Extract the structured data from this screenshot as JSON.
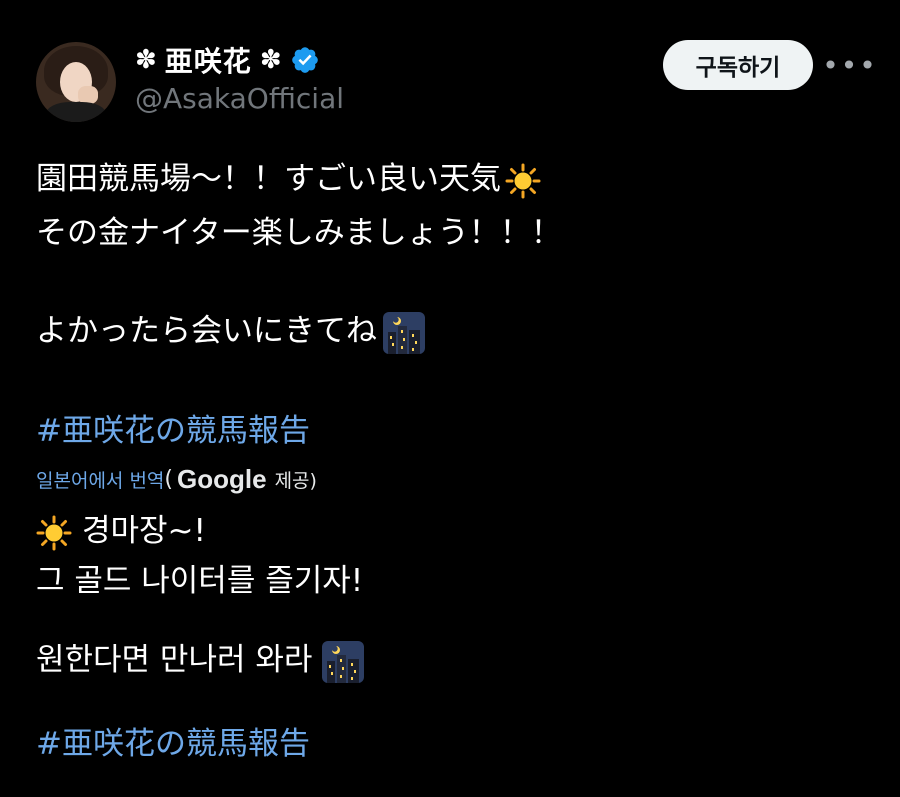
{
  "author": {
    "name_prefix": "✽",
    "display_name": "亜咲花",
    "name_suffix": "✽",
    "handle": "@AsakaOfficial"
  },
  "actions": {
    "follow_label": "구독하기",
    "more_label": "•••"
  },
  "tweet": {
    "line1": "園田競馬場〜！！すごい良い天気",
    "line2": "その金ナイター楽しみましょう！！！",
    "line3": "よかったら会いにきてね",
    "hashtag": "#亜咲花の競馬報告"
  },
  "translation": {
    "link_label": "일본어에서 번역",
    "open_paren": "(",
    "provider": "Google",
    "provide_label": "제공)",
    "line1": "경마장~!",
    "line2": "그 골드 나이터를 즐기자!",
    "line3": "원한다면 만나러 와라",
    "hashtag": "#亜咲花の競馬報告"
  },
  "icons": {
    "verified": "verified-badge-icon",
    "sun": "sun-emoji-icon",
    "night_city": "night-city-emoji-icon",
    "more": "more-dots-icon"
  },
  "colors": {
    "background": "#000000",
    "link": "#6ea8e8",
    "verified": "#1d9bf0",
    "handle": "#71767b"
  }
}
